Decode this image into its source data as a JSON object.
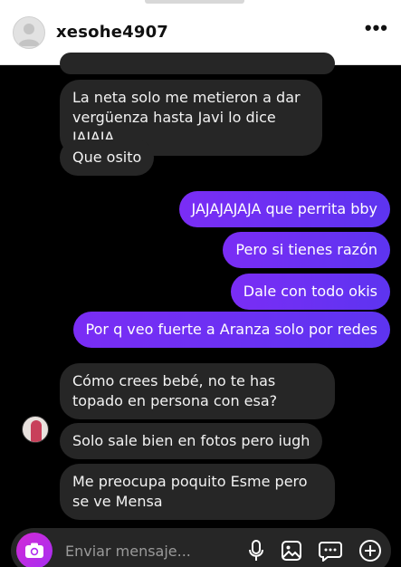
{
  "header": {
    "username": "xesohe4907",
    "more_label": "•••"
  },
  "messages": [
    {
      "side": "in",
      "text": "La neta solo me metieron a dar vergüenza hasta Javi lo dice JAJAJA"
    },
    {
      "side": "in",
      "text": "Que osito"
    },
    {
      "side": "out",
      "text": "JAJAJAJAJA que perrita bby"
    },
    {
      "side": "out",
      "text": "Pero si tienes razón"
    },
    {
      "side": "out",
      "text": "Dale con todo okis"
    },
    {
      "side": "out",
      "text": "Por q veo fuerte a Aranza solo por redes"
    },
    {
      "side": "in",
      "text": "Cómo crees bebé, no te has topado en persona con esa?"
    },
    {
      "side": "in",
      "text": "Solo sale bien en fotos pero iugh"
    },
    {
      "side": "in",
      "text": "Me preocupa poquito Esme pero se ve Mensa"
    }
  ],
  "composer": {
    "placeholder": "Enviar mensaje..."
  },
  "icons": {
    "camera": "camera-icon",
    "mic": "microphone-icon",
    "gallery": "gallery-icon",
    "sticker": "sticker-icon",
    "add": "plus-circle-icon"
  }
}
